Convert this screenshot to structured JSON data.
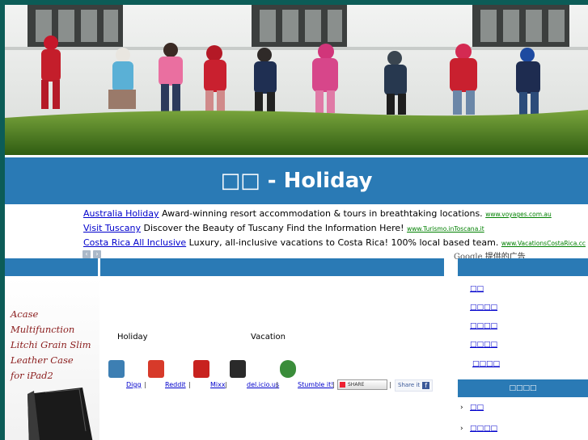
{
  "page": {
    "title": "□□ - Holiday"
  },
  "ads": [
    {
      "link": "Australia Holiday",
      "text": "Award-winning resort accommodation & tours in breathtaking locations.",
      "url": "www.voyages.com.au"
    },
    {
      "link": "Visit Tuscany",
      "text": "Discover the Beauty of Tuscany Find the Information Here!",
      "url": "www.Turismo.inToscana.it"
    },
    {
      "link": "Costa Rica All Inclusive",
      "text": "Luxury, all-inclusive vacations to Costa Rica! 100% local based team.",
      "url": "www.VacationsCostaRica.cc"
    }
  ],
  "ad_nav": {
    "prev": "‹",
    "next": "›"
  },
  "google_ads": {
    "brand": "Google",
    "label": "提供的广告"
  },
  "product": {
    "lines": [
      "Acase Multifunction",
      "Litchi Grain Slim",
      "Leather Case",
      "for iPad2"
    ]
  },
  "main": {
    "keyword_left": "Holiday",
    "keyword_right": "Vacation"
  },
  "share": {
    "digg": "Digg",
    "reddit": "Reddit",
    "mixx": "Mixx",
    "delicious": "del.icio.us",
    "stumble": "Stumble it!",
    "sep": "|",
    "addthis": "SHARE",
    "facebook": "Share it",
    "facebook_f": "f"
  },
  "sidebar": {
    "nav": [
      "□□",
      "□□□□",
      "□□□□",
      "□□□□",
      "□□□□"
    ],
    "header": "□□□□",
    "list": [
      "□□",
      "□□□□"
    ],
    "arrow": "›"
  },
  "colors": {
    "brand_blue": "#2a7ab5",
    "frame_teal": "#0c5c57",
    "link_blue": "#0000cc",
    "url_green": "#008000"
  }
}
